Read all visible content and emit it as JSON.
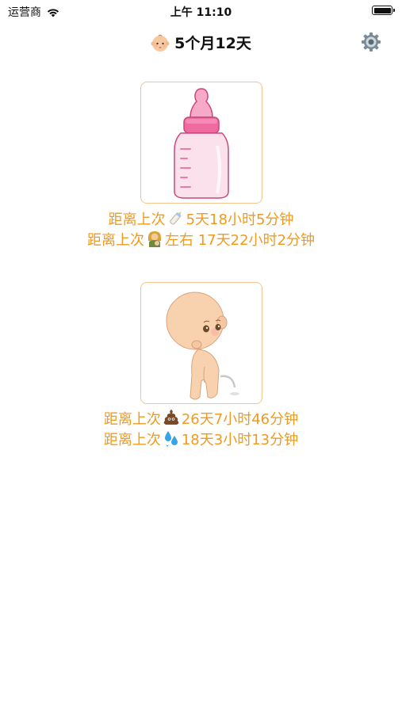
{
  "status_bar": {
    "carrier": "运营商",
    "time": "上午 11:10"
  },
  "nav": {
    "title": "5个月12天"
  },
  "feeding": {
    "line1_prefix": "距离上次",
    "line1_value": "5天18小时5分钟",
    "line2_prefix": "距离上次",
    "line2_value": "左右 17天22小时2分钟"
  },
  "toilet": {
    "line1_prefix": "距离上次",
    "line1_value": "26天7小时46分钟",
    "line2_prefix": "距离上次",
    "line2_value": "18天3小时13分钟"
  },
  "icons": {
    "title": "baby-face-icon",
    "settings": "gear-icon",
    "feeding_card": "baby-bottle-icon",
    "toilet_card": "baby-peeing-icon",
    "line_bottle": "bottle-icon",
    "line_breastfeeding": "breastfeeding-icon",
    "line_poop": "poop-icon",
    "line_water": "water-drops-icon"
  },
  "colors": {
    "accent_text": "#f29a1b",
    "card_border": "#f3c58e"
  }
}
